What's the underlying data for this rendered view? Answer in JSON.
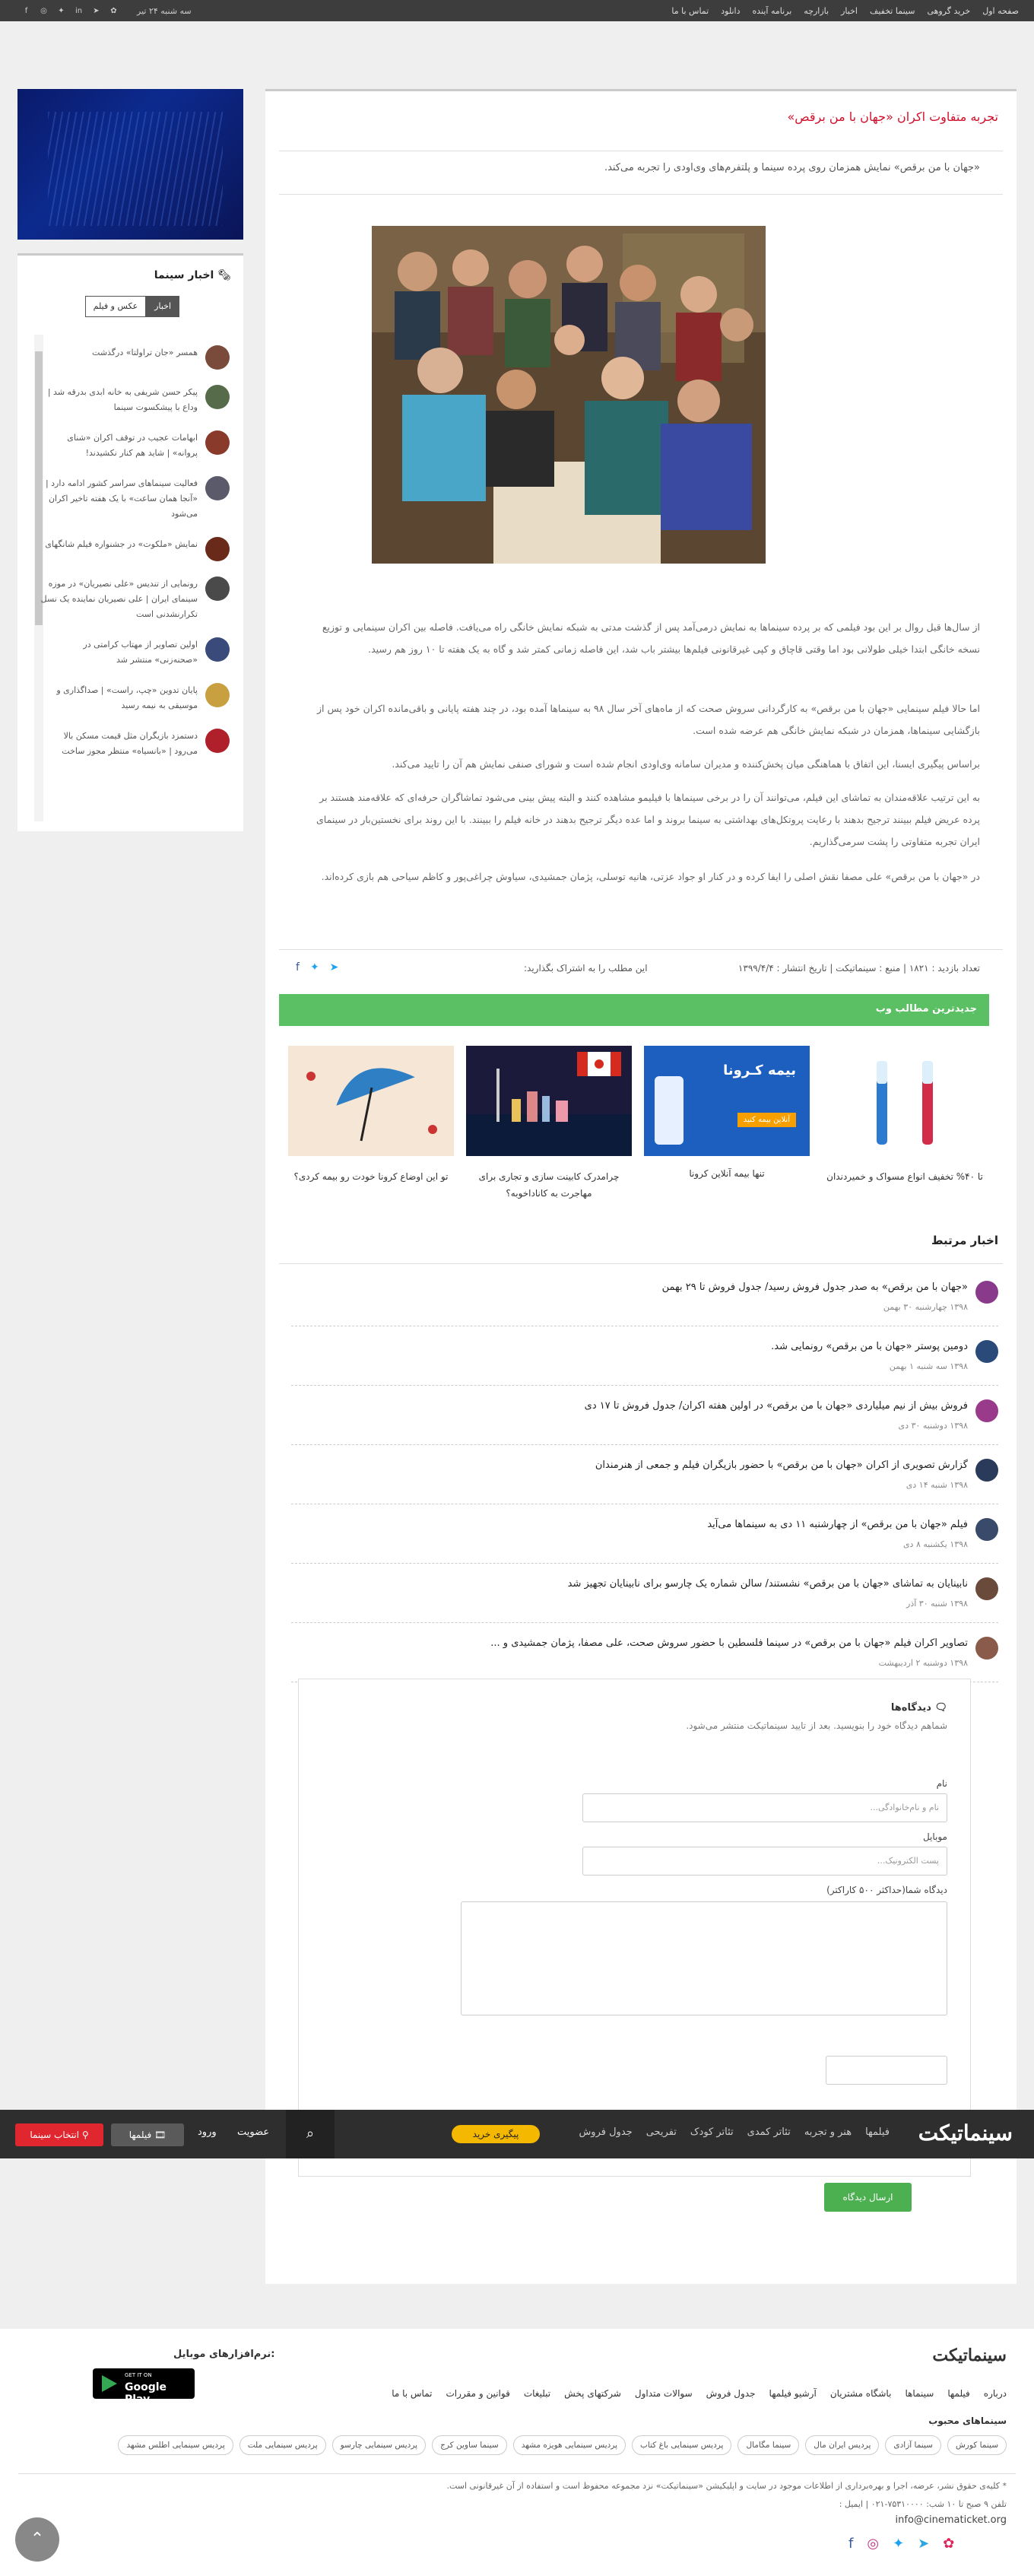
{
  "topbar": {
    "menu": [
      "صفحه اول",
      "خرید گروهی",
      "سینما تخفیف",
      "اخبار",
      "بازارچه",
      "برنامه آینده",
      "دانلود",
      "تماس با ما"
    ],
    "date": "سه شنبه ۲۴ تیر"
  },
  "sidebar": {
    "news_title": "اخبار سینما",
    "tab_news": "اخبار",
    "tab_photo": "عکس و فیلم",
    "items": [
      "همسر «جان تراولتا» درگذشت",
      "پیکر حسن شریفی به خانه ابدی بدرقه شد | وداع با پیشکسوت سینما",
      "ابهامات عجیب در توقف اکران «شنای پروانه» | شاید هم کنار نکشیدند!",
      "فعالیت سینماهای سراسر کشور ادامه دارد | «آنجا همان ساعت» با یک هفته تاخیر اکران می‌شود",
      "نمایش «ملکوت» در جشنواره فیلم شانگهای",
      "رونمایی از تندیس «علی نصیریان» در موزه سینمای ایران | علی نصیریان نماینده یک نسل تکرارنشدنی است",
      "اولین تصاویر از مهتاب کرامتی در «صحنه‌زنی» منتشر شد",
      "پایان تدوین «چپ، راست» | صداگذاری و موسیقی به نیمه رسید",
      "دستمزد بازیگران مثل قیمت مسکن بالا می‌رود | «بانسیاه» منتظر مجوز ساخت"
    ]
  },
  "article": {
    "title": "تجربه متفاوت اکران «جهان با من برقص»",
    "lead": "«جهان با من برقص» نمایش همزمان روی پرده سینما و پلتفرم‌های وی‌اودی را تجربه می‌کند.",
    "paragraphs": [
      "از سال‌ها قبل روال بر این بود فیلمی که بر پرده سینماها به نمایش درمی‌آمد پس از گذشت مدتی به شبکه نمایش خانگی راه می‌یافت. فاصله بین اکران سینمایی و توزیع نسخه خانگی ابتدا خیلی طولانی بود اما وقتی قاچاق و کپی غیرقانونی فیلم‌ها بیشتر باب شد، این فاصله زمانی کمتر شد و گاه به یک هفته تا ۱۰ روز هم رسید.",
      "اما حالا فیلم سینمایی «جهان با من برقص» به کارگردانی سروش صحت که از ماه‌های آخر سال ۹۸ به سینماها آمده بود، در چند هفته پایانی و باقی‌مانده اکران خود پس از بازگشایی سینماها، همزمان در شبکه نمایش خانگی هم عرضه شده است.",
      "براساس پیگیری ایسنا، این اتفاق با هماهنگی میان پخش‌کننده و مدیران سامانه وی‌اودی انجام شده است و شورای صنفی نمایش هم آن را تایید می‌کند.",
      "به این ترتیب علاقه‌مندان به تماشای این فیلم، می‌توانند آن را در برخی سینماها با فیلیمو مشاهده کنند و البته پیش بینی می‌شود تماشاگران حرفه‌ای که علاقه‌مند هستند بر پرده عریض فیلم ببینند ترجیح بدهند با رعایت پروتکل‌های بهداشتی به سینما بروند و اما عده دیگر ترجیح بدهند در خانه فیلم را ببینند. با این روند برای نخستین‌بار در سینمای ایران تجربه متفاوتی را پشت سرمی‌گذاریم.",
      "در «جهان با من برقص» علی مصفا نقش اصلی را ایفا کرده و در کنار او جواد عزتی، هانیه توسلی، پژمان جمشیدی، سیاوش چراغی‌پور و کاظم سیاحی هم بازی کرده‌اند."
    ],
    "meta": "تعداد بازدید : ۱۸۲۱ | منبع : سینماتیکت | تاریخ انتشار : ۱۳۹۹/۴/۴",
    "share_label": "این مطلب را به اشتراک بگذارید:"
  },
  "latest": {
    "title": "جدیدترین مطالب وب",
    "cards": [
      {
        "title": "تا ۴۰% تخفیف انواع مسواک و خمیردندان"
      },
      {
        "title": "تنها بیمه آنلاین کرونا"
      },
      {
        "title": "چرامدرک کابینت سازی و تجاری برای مهاجرت به کاناداخوبه؟"
      },
      {
        "title": "تو این اوضاع کرونا خودت رو بیمه کردی؟"
      }
    ],
    "corona_ad": {
      "line1": "بیمه کـرونا",
      "line2": "آنلاین بیمه کنید"
    }
  },
  "related": {
    "title": "اخبار مرتبط",
    "items": [
      {
        "title": "«جهان با من برقص» به صدر جدول فروش رسید/ جدول فروش تا ۲۹ بهمن",
        "date": "۱۳۹۸ چهارشنبه ۳۰ بهمن"
      },
      {
        "title": "دومین پوستر «جهان با من برقص» رونمایی شد.",
        "date": "۱۳۹۸ سه شنبه ۱ بهمن"
      },
      {
        "title": "فروش بیش از نیم میلیاردی «جهان با من برقص» در اولین هفته اکران/ جدول فروش تا ۱۷ دی",
        "date": "۱۳۹۸ دوشنبه ۳۰ دی"
      },
      {
        "title": "گزارش تصویری از اکران «جهان با من برقص» با حضور بازیگران فیلم و جمعی از هنرمندان",
        "date": "۱۳۹۸ شنبه ۱۴ دی"
      },
      {
        "title": "فیلم «جهان با من برقص» از چهارشنبه ۱۱ دی به سینماها می‌آید",
        "date": "۱۳۹۸ یکشنبه ۸ دی"
      },
      {
        "title": "نابینایان به تماشای «جهان با من برقص» نشستند/ سالن شماره یک چارسو برای نابینایان تجهیز شد",
        "date": "۱۳۹۸ شنبه ۳۰ آذر"
      },
      {
        "title": "تصاویر اکران فیلم «جهان با من برقص» در سینما فلسطین با حضور سروش صحت، علی مصفا، پژمان جمشیدی و ...",
        "date": "۱۳۹۸ دوشنبه ۲ اردیبهشت"
      }
    ]
  },
  "comments": {
    "title": "دیدگاه‌ها",
    "subtitle": "شماهم دیدگاه خود را بنویسید. بعد از تایید سینماتیکت منتشر می‌شود.",
    "name_label": "نام",
    "name_placeholder": "نام و نام‌خانوادگی...",
    "mobile_label": "موبایل",
    "mobile_placeholder": "پست الکترونیک...",
    "comment_label": "دیدگاه شما(حداکثر ۵۰۰ کاراکتر)",
    "submit": "ارسال دیدگاه"
  },
  "navbar": {
    "logo": "سینماتیکت",
    "links": [
      "فیلمها",
      "هنر و تجربه",
      "تئاتر کمدی",
      "تئاتر کودک",
      "تفریحی",
      "جدول فروش"
    ],
    "buy": "پیگیری خرید",
    "account": "عضویت",
    "login": "ورود",
    "films": "فیلمها",
    "choose": "انتخاب سینما"
  },
  "footer": {
    "logo": "سینماتیکت",
    "links": [
      "درباره",
      "فیلمها",
      "سینماها",
      "باشگاه مشتریان",
      "آرشیو فیلمها",
      "جدول فروش",
      "سوالات متداول",
      "شرکتهای پخش",
      "تبلیغات",
      "قوانین و مقررات",
      "تماس با ما"
    ],
    "popular_title": "سینماهای محبوب",
    "popular": [
      "سینما کورش",
      "سینما آزادی",
      "پردیس ایران مال",
      "سینما مگامال",
      "پردیس سینمایی باغ کتاب",
      "پردیس سینمایی هویزه مشهد",
      "سینما ساوین کرج",
      "پردیس سینمایی چارسو",
      "پردیس سینمایی ملت",
      "پردیس سینمایی اطلس مشهد"
    ],
    "copyright": "* کلیه‌ی حقوق نشر، عرضه، اجرا و بهره‌برداری از اطلاعات موجود در سایت و اپلیکیشن «سینماتیکت» نزد مجموعه محفوظ است و استفاده از آن غیرقانونی است.",
    "phone": "تلفن ۹ صبح تا ۱۰ شب: ۷۵۳۱۰۰۰۰-۰۲۱ | ایمیل :",
    "email": "info@cinematicket.org",
    "app_title": "نرم‌افزارهای موبایل:",
    "gplay_small": "GET IT ON",
    "gplay_big": "Google Play"
  },
  "colors": {
    "accent_red": "#d0102a",
    "green": "#5bbf63",
    "nav_bg": "#2e2e2e",
    "buy_yellow": "#f5b800"
  }
}
